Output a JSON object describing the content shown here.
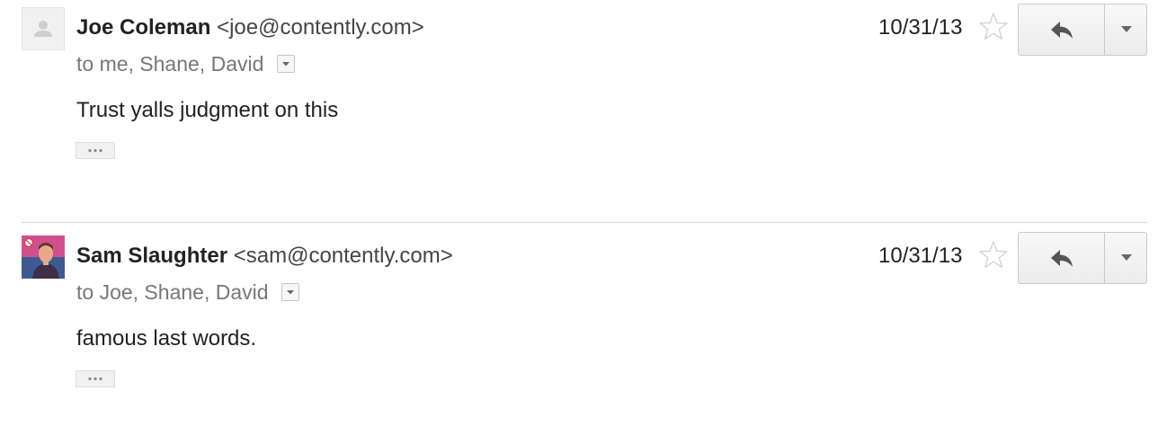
{
  "messages": [
    {
      "sender_name": "Joe Coleman",
      "sender_email": "<joe@contently.com>",
      "recipients": "to me, Shane, David",
      "date": "10/31/13",
      "body": "Trust yalls judgment on this",
      "avatar": "default-person-icon"
    },
    {
      "sender_name": "Sam Slaughter",
      "sender_email": "<sam@contently.com>",
      "recipients": "to Joe, Shane, David",
      "date": "10/31/13",
      "body": "famous last words.",
      "avatar": "profile-photo"
    }
  ],
  "icons": {
    "star": "star-outline-icon",
    "reply": "reply-arrow-icon",
    "more": "caret-down-icon",
    "show_details": "caret-down-icon",
    "trimmed_content": "ellipsis-icon"
  },
  "colors": {
    "text": "#222222",
    "secondary_text": "#777777",
    "divider": "#d8d8d8",
    "button_bg": "#f1f1f1"
  }
}
